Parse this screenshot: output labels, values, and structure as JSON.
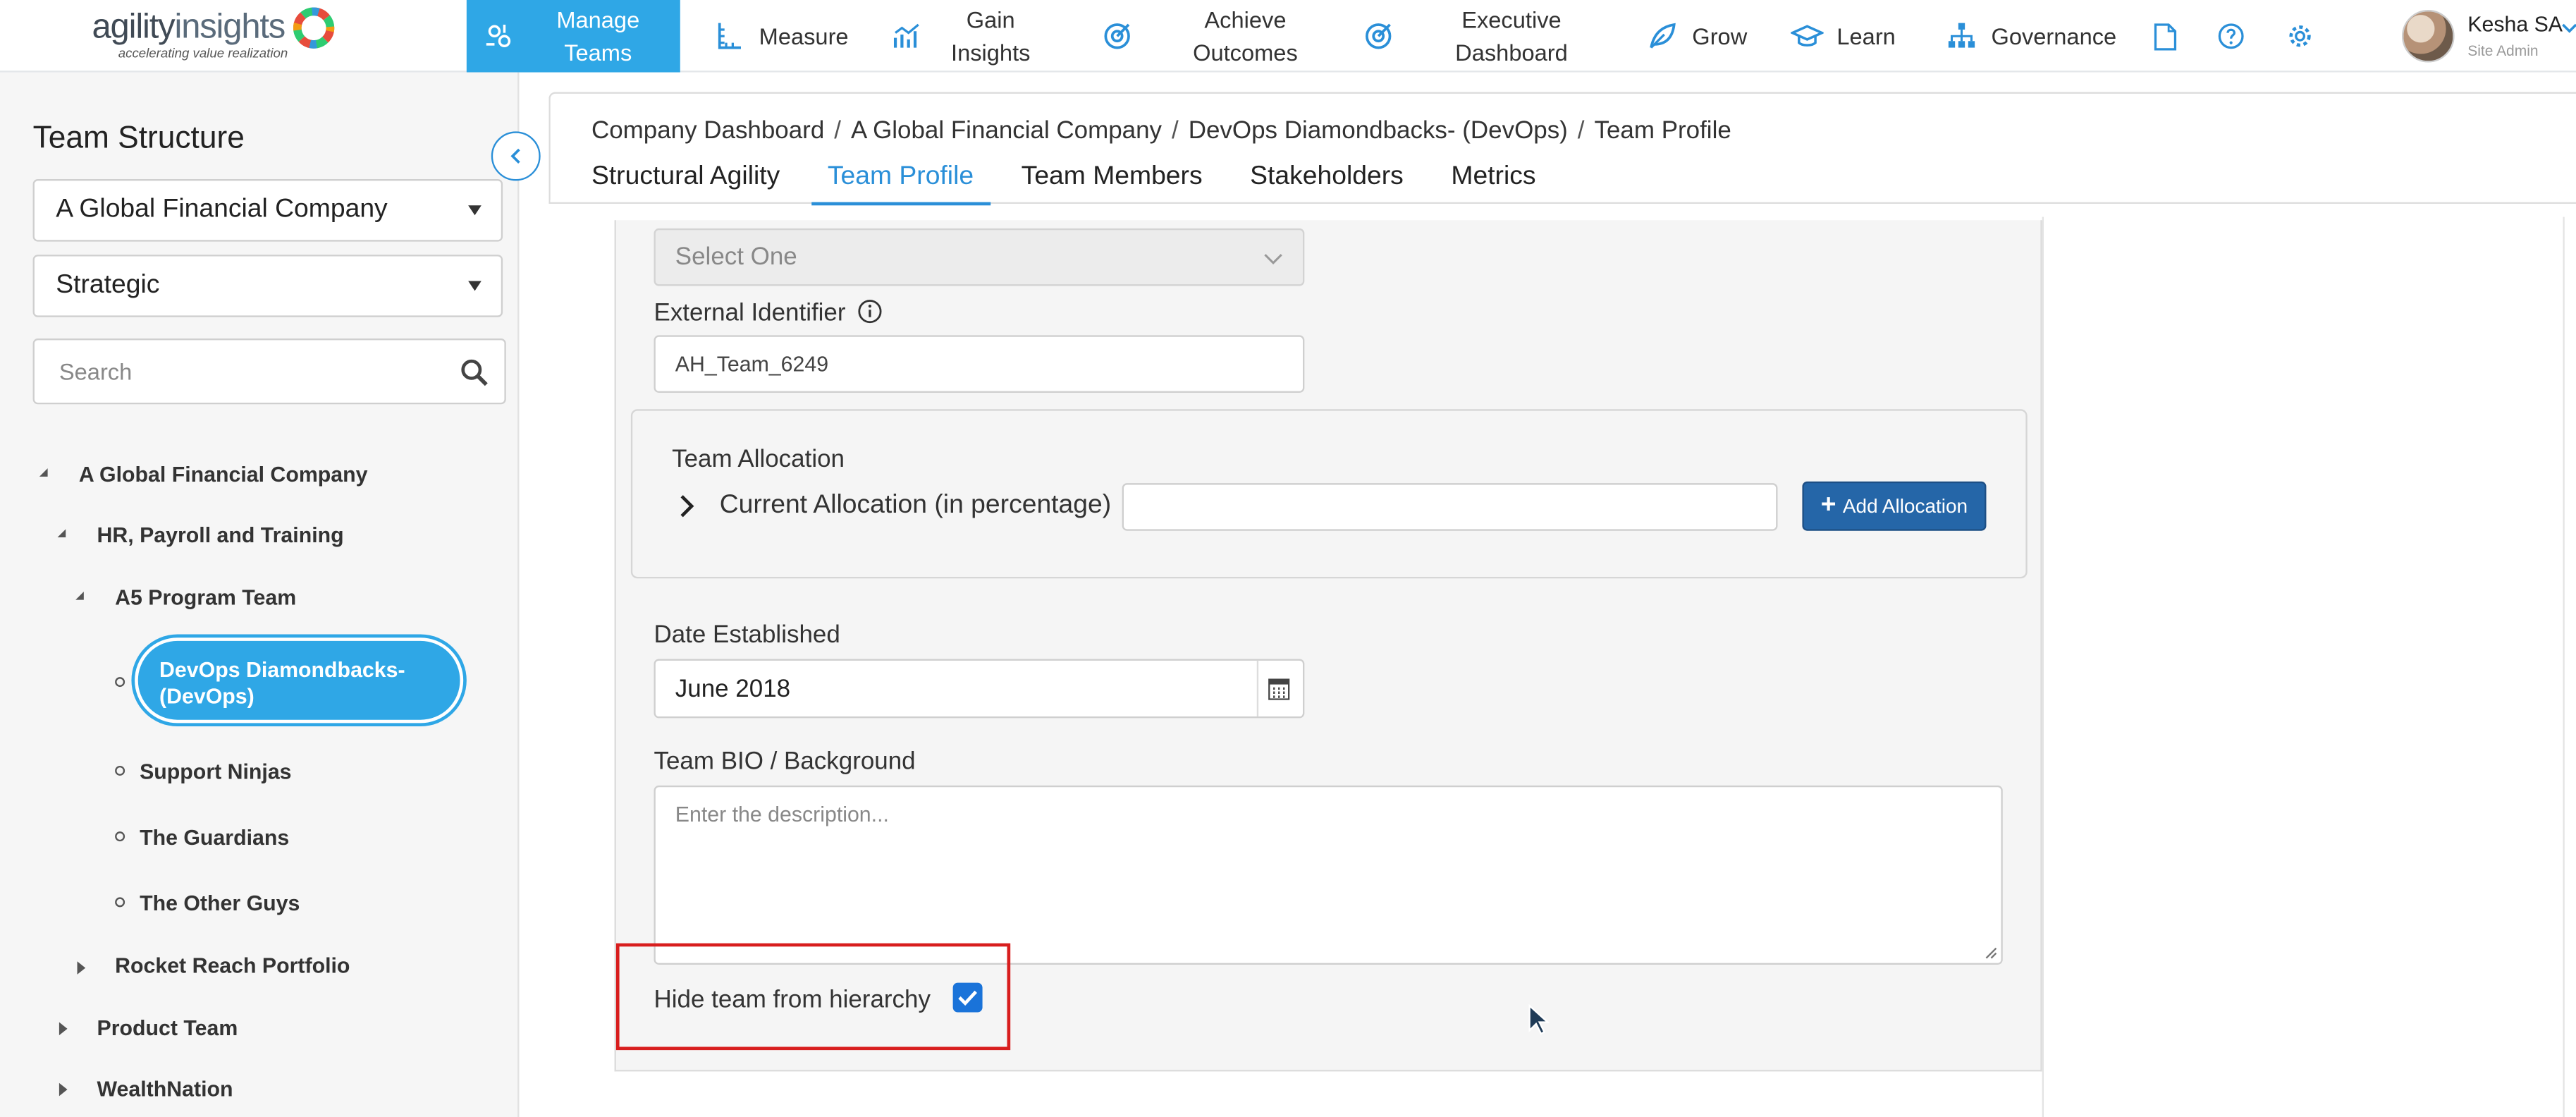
{
  "app": {
    "logo_text_agility": "agility",
    "logo_text_insights": "insights",
    "logo_tagline": "accelerating value realization"
  },
  "nav": {
    "manage_teams": "Manage Teams",
    "measure": "Measure",
    "gain_insights": "Gain Insights",
    "achieve_outcomes": "Achieve Outcomes",
    "executive_dashboard": "Executive Dashboard",
    "grow": "Grow",
    "learn": "Learn",
    "governance": "Governance",
    "accent_color": "#2fa7e6"
  },
  "user": {
    "name": "Kesha SA",
    "role": "Site Admin"
  },
  "sidebar": {
    "title": "Team Structure",
    "company_select": "A Global Financial Company",
    "level_select": "Strategic",
    "search_placeholder": "Search",
    "tree": {
      "root": "A Global Financial Company",
      "hr": "HR, Payroll and Training",
      "a5": "A5 Program Team",
      "selected_line1": "DevOps Diamondbacks-",
      "selected_line2": "(DevOps)",
      "support": "Support Ninjas",
      "guardians": "The Guardians",
      "other": "The Other Guys",
      "rocket": "Rocket Reach Portfolio",
      "product": "Product Team",
      "wealth": "WealthNation"
    }
  },
  "breadcrumb": {
    "items": [
      "Company Dashboard",
      "A Global Financial Company",
      "DevOps Diamondbacks- (DevOps)",
      "Team Profile"
    ],
    "separator": "/"
  },
  "tabs": {
    "structural": "Structural Agility",
    "profile": "Team Profile",
    "members": "Team Members",
    "stakeholders": "Stakeholders",
    "metrics": "Metrics"
  },
  "form": {
    "select_placeholder": "Select One",
    "external_id_label": "External Identifier",
    "external_id_value": "AH_Team_6249",
    "allocation_title": "Team Allocation",
    "current_allocation_label": "Current Allocation (in percentage)",
    "current_allocation_value": "",
    "add_allocation": "Add Allocation",
    "date_label": "Date Established",
    "date_value": "June 2018",
    "bio_label": "Team BIO / Background",
    "bio_placeholder": "Enter the description...",
    "hide_label": "Hide team from hierarchy",
    "hide_checked": true
  }
}
